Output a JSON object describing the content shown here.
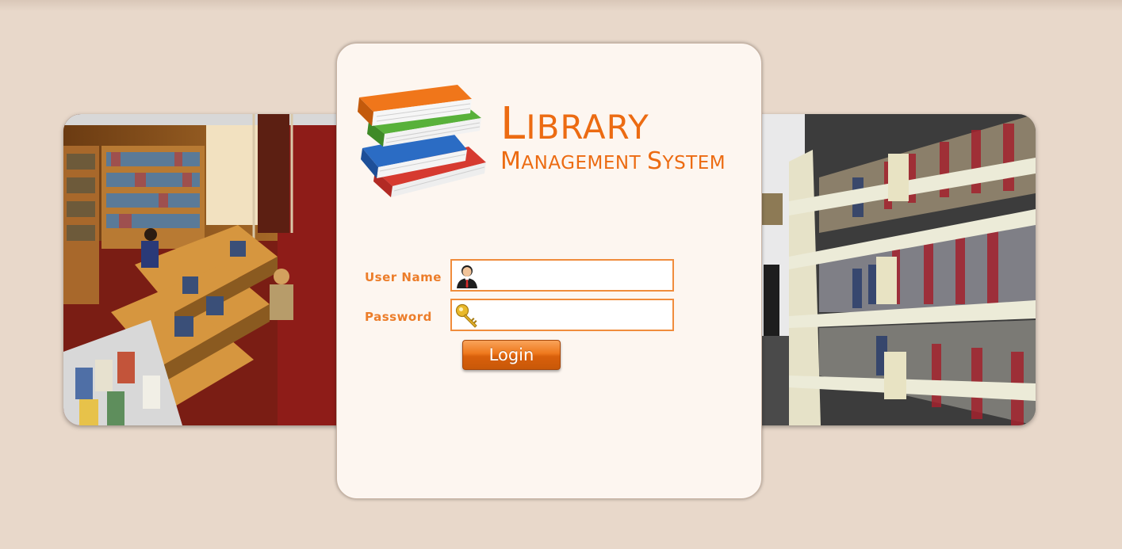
{
  "app": {
    "title_first_letter": "L",
    "title_rest": "IBRARY",
    "subtitle_w1_first": "M",
    "subtitle_w1_rest": "ANAGEMENT",
    "subtitle_w2_first": "S",
    "subtitle_w2_rest": "YSTEM"
  },
  "login_form": {
    "username_label": "User Name",
    "username_value": "",
    "password_label": "Password",
    "password_value": "",
    "submit_label": "Login"
  },
  "icons": {
    "logo": "stacked-books-icon",
    "username": "user-avatar-icon",
    "password": "key-icon"
  },
  "colors": {
    "background": "#e8d8ca",
    "card": "#fdf6f0",
    "accent": "#ec6b12",
    "field_border": "#f08c3c"
  }
}
